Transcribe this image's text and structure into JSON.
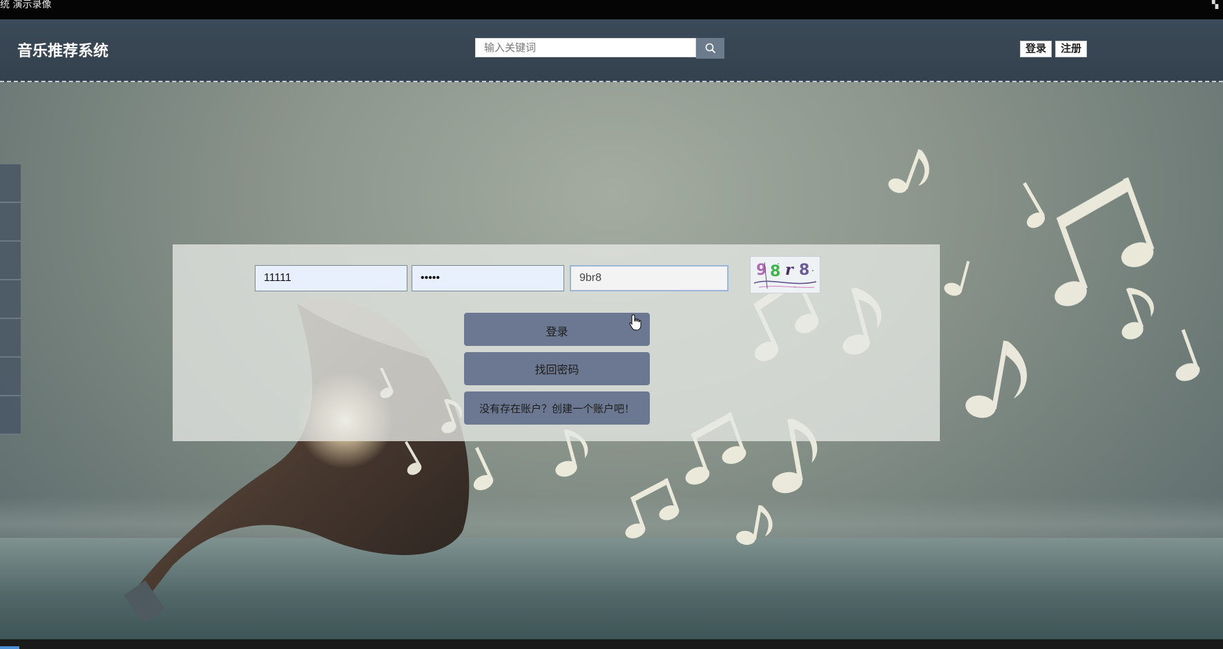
{
  "window": {
    "title": "统 演示录像"
  },
  "header": {
    "brand": "音乐推荐系统",
    "search": {
      "placeholder": "输入关键词",
      "value": ""
    },
    "login_label": "登录",
    "register_label": "注册"
  },
  "login_form": {
    "username": "11111",
    "password": "•••••",
    "captcha_input": "9br8",
    "captcha_image_text": "9 8 r 8",
    "submit_label": "登录",
    "forgot_label": "找回密码",
    "create_account_label": "没有存在账户？创建一个账户吧！"
  },
  "icons": {
    "search_button": "search-icon",
    "cursor": "hand-pointer-icon",
    "window_control": "restore-icon"
  },
  "colors": {
    "header_bg": "#3b4a58",
    "button_bg": "#6c7891",
    "search_button_bg": "#6b7b8c",
    "panel_bg": "rgba(230,232,228,0.78)"
  }
}
